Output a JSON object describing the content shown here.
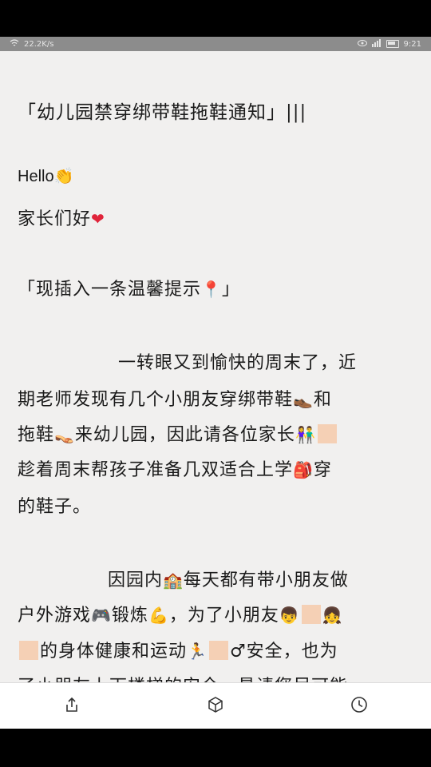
{
  "status_bar": {
    "network_speed": "22.2K/s",
    "time": "9:21"
  },
  "article": {
    "title": "「幼儿园禁穿绑带鞋拖鞋通知」|||",
    "hello": "Hello",
    "greeting": "家长们好",
    "notice": "「现插入一条温馨提示",
    "notice_end": "」",
    "p1": "一转眼又到愉快的周末了，近",
    "p2a": "期老师发现有几个小朋友穿绑带鞋",
    "p2b": "和",
    "p3a": "拖鞋",
    "p3b": "来幼儿园，因此请各位家长",
    "p4a": "趁着周末帮孩子准备几双适合上学",
    "p4b": "穿",
    "p5": "的鞋子。",
    "p6": "因园内",
    "p6b": "每天都有带小朋友做",
    "p7a": "户外游戏",
    "p7b": "锻炼",
    "p7c": "，为了小朋友",
    "p8a": "的身体健康和运动",
    "p8b": "♂安全，也为",
    "p9": "了小朋友上下楼梯的安全，恳请您尽可能"
  },
  "icons": {
    "clap": "👏",
    "heart": "❤",
    "pin": "📍",
    "boot": "👞",
    "heel": "👡",
    "couple": "👫",
    "backpack": "🎒",
    "building": "🏫",
    "gamepad": "🎮",
    "muscle": "💪",
    "boy": "👦",
    "girl": "👧",
    "runner": "🏃"
  },
  "tab_bar": {
    "share": "share-icon",
    "cube": "cube-icon",
    "history": "clock-icon"
  }
}
